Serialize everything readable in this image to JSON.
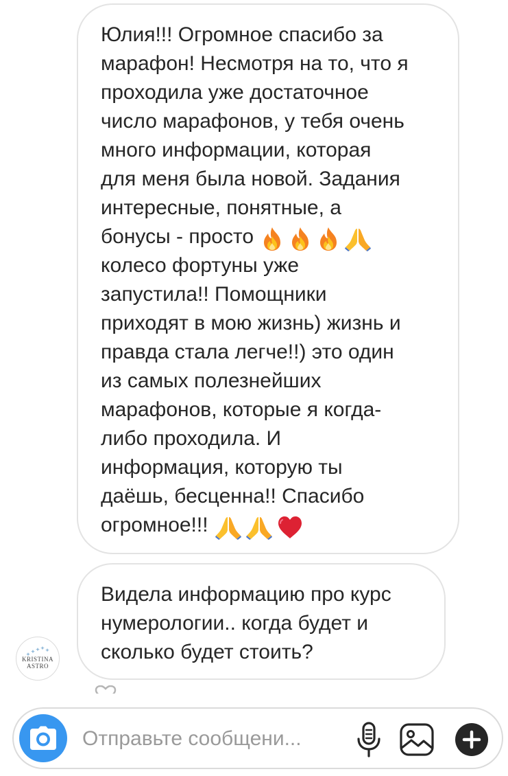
{
  "messages": [
    {
      "lines": [
        "Юлия!!! Огромное спасибо за",
        "марафон! Несмотря на то, что я",
        "проходила уже достаточное",
        "число марафонов, у тебя очень",
        "много информации, которая",
        "для меня была новой. Задания",
        "интересные, понятные, а",
        "бонусы - просто",
        "колесо фортуны уже",
        "запустила!! Помощники",
        "приходят в мою жизнь) жизнь и",
        "правда стала легче!!) это один",
        "из самых полезнейших",
        "марафонов, которые я когда-",
        "либо проходила. И",
        "информация, которую ты",
        "даёшь, бесценна!! Спасибо",
        "огромное!!!"
      ],
      "emoji_after_line_8": [
        "fire",
        "fire",
        "fire",
        "folded-hands"
      ],
      "emoji_after_line_18": [
        "folded-hands",
        "folded-hands",
        "red-heart"
      ]
    },
    {
      "lines": [
        "Видела информацию про курс",
        "нумерологии.. когда будет и",
        "сколько будет стоить?"
      ]
    }
  ],
  "sender_avatar": {
    "line1": "KRISTINA",
    "line2": "ASTRO",
    "icon": "stars-logo"
  },
  "composer": {
    "placeholder": "Отправьте сообщени...",
    "camera_icon": "camera-icon",
    "mic_icon": "microphone-icon",
    "gallery_icon": "gallery-icon",
    "plus_icon": "plus-icon"
  },
  "colors": {
    "accent_blue": "#3897f0",
    "bubble_border": "#e3e3e3",
    "text": "#262626",
    "placeholder": "#9a9a9a"
  }
}
